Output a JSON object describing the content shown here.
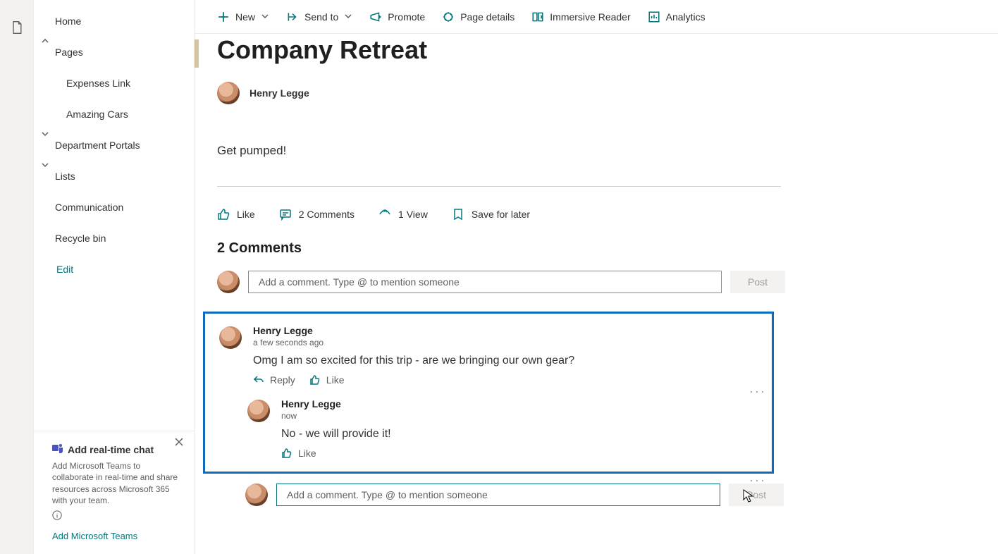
{
  "sidebar": {
    "items": [
      {
        "label": "Home"
      },
      {
        "label": "Pages",
        "chev": "up"
      },
      {
        "label": "Expenses Link",
        "child": true
      },
      {
        "label": "Amazing Cars",
        "child": true
      },
      {
        "label": "Department Portals",
        "chev": "down"
      },
      {
        "label": "Lists",
        "chev": "down"
      },
      {
        "label": "Communication",
        "child": false
      },
      {
        "label": "Recycle bin",
        "child": false
      }
    ],
    "edit": "Edit"
  },
  "promo": {
    "title": "Add real-time chat",
    "desc": "Add Microsoft Teams to collaborate in real-time and share resources across Microsoft 365 with your team.",
    "link": "Add Microsoft Teams"
  },
  "toolbar": {
    "new": "New",
    "send_to": "Send to",
    "promote": "Promote",
    "page_details": "Page details",
    "immersive_reader": "Immersive Reader",
    "analytics": "Analytics"
  },
  "page": {
    "title": "Company Retreat",
    "author": "Henry Legge",
    "body": "Get pumped!"
  },
  "actions": {
    "like": "Like",
    "comments": "2 Comments",
    "views": "1 View",
    "save": "Save for later"
  },
  "comments": {
    "header": "2 Comments",
    "placeholder": "Add a comment. Type @ to mention someone",
    "post": "Post",
    "list": [
      {
        "author": "Henry Legge",
        "time": "a few seconds ago",
        "text": "Omg I am so excited for this trip - are we bringing our own gear?",
        "reply_label": "Reply",
        "like_label": "Like"
      },
      {
        "author": "Henry Legge",
        "time": "now",
        "text": "No - we will provide it!",
        "like_label": "Like"
      }
    ]
  }
}
